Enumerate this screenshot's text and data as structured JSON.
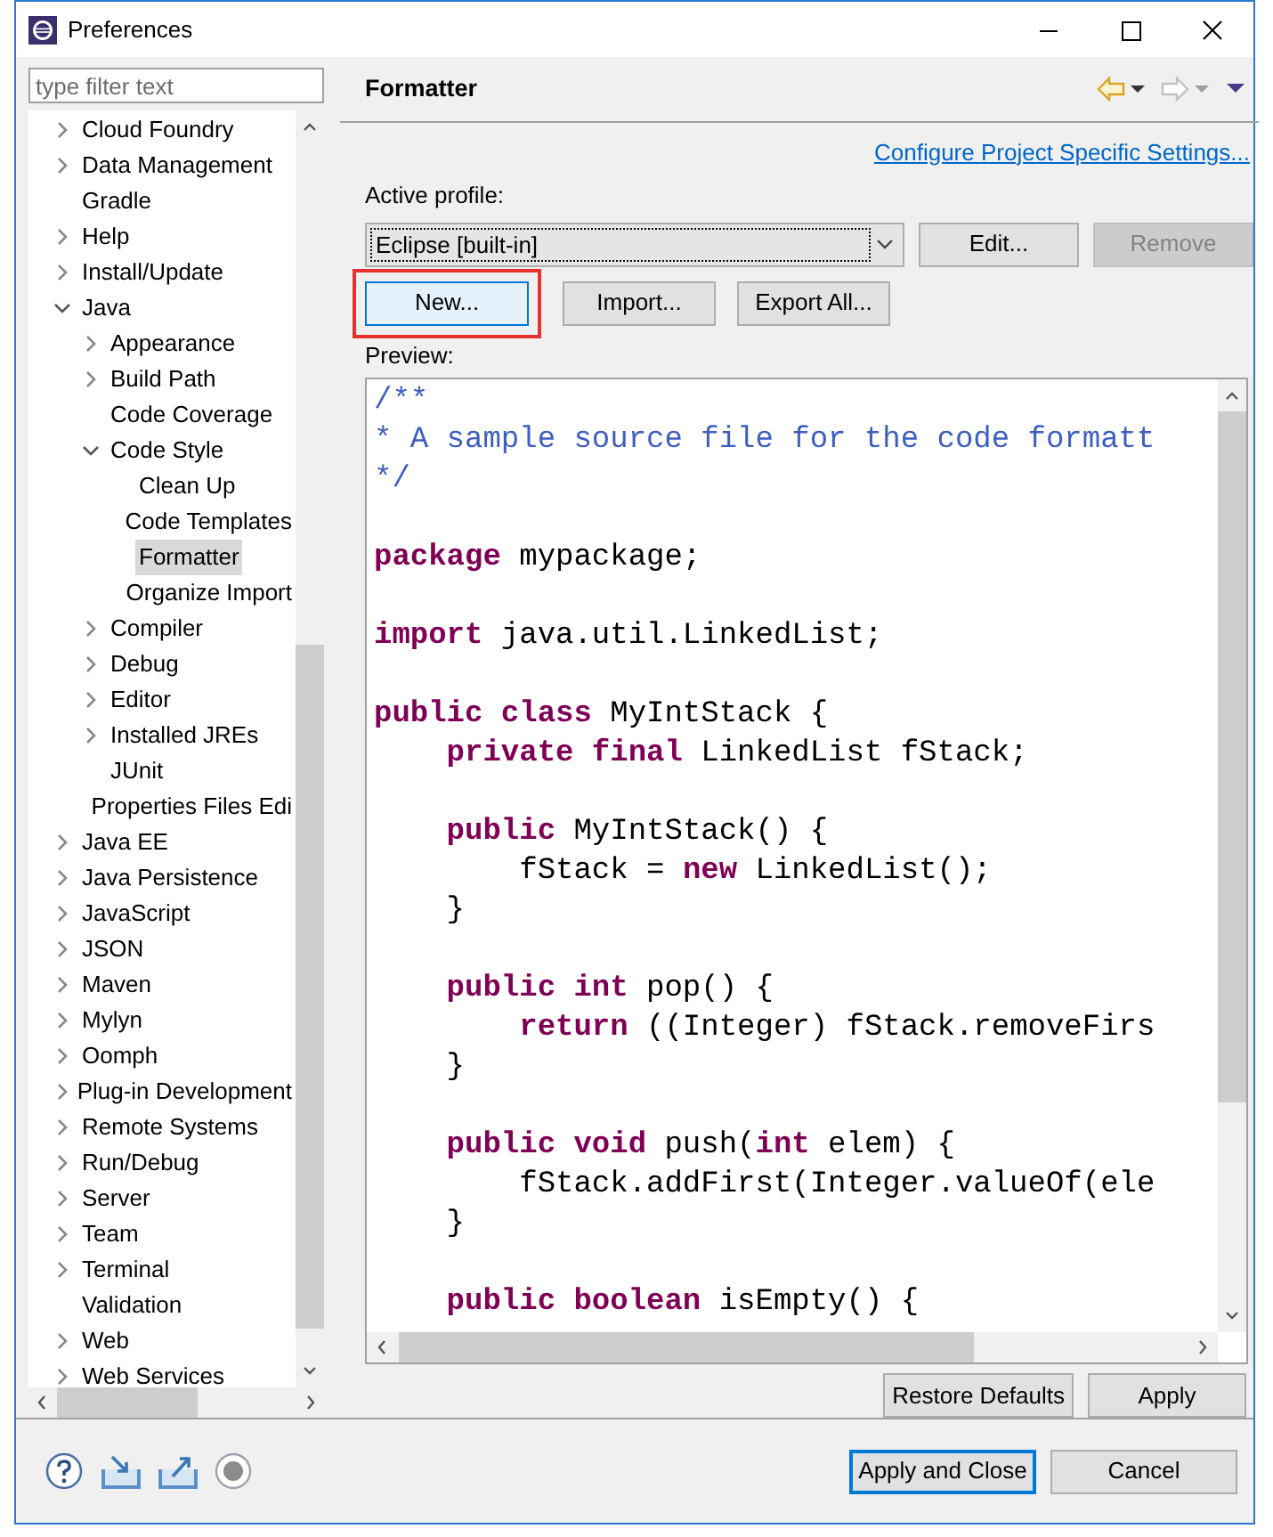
{
  "window": {
    "title": "Preferences"
  },
  "filter": {
    "placeholder": "type filter text"
  },
  "tree": [
    {
      "label": "Cloud Foundry",
      "expanded": false,
      "selected": false
    },
    {
      "label": "Data Management",
      "expanded": false,
      "selected": false
    },
    {
      "label": "Gradle",
      "selected": false
    },
    {
      "label": "Help",
      "expanded": false,
      "selected": false
    },
    {
      "label": "Install/Update",
      "expanded": false,
      "selected": false
    },
    {
      "label": "Java",
      "expanded": true,
      "selected": false,
      "children": [
        {
          "label": "Appearance",
          "expanded": false,
          "selected": false
        },
        {
          "label": "Build Path",
          "expanded": false,
          "selected": false
        },
        {
          "label": "Code Coverage",
          "selected": false
        },
        {
          "label": "Code Style",
          "expanded": true,
          "selected": false,
          "children": [
            {
              "label": "Clean Up",
              "selected": false
            },
            {
              "label": "Code Templates",
              "selected": false
            },
            {
              "label": "Formatter",
              "selected": true
            },
            {
              "label": "Organize Import",
              "selected": false
            }
          ]
        },
        {
          "label": "Compiler",
          "expanded": false,
          "selected": false
        },
        {
          "label": "Debug",
          "expanded": false,
          "selected": false
        },
        {
          "label": "Editor",
          "expanded": false,
          "selected": false
        },
        {
          "label": "Installed JREs",
          "expanded": false,
          "selected": false
        },
        {
          "label": "JUnit",
          "selected": false
        },
        {
          "label": "Properties Files Edi",
          "selected": false
        }
      ]
    },
    {
      "label": "Java EE",
      "expanded": false,
      "selected": false
    },
    {
      "label": "Java Persistence",
      "expanded": false,
      "selected": false
    },
    {
      "label": "JavaScript",
      "expanded": false,
      "selected": false
    },
    {
      "label": "JSON",
      "expanded": false,
      "selected": false
    },
    {
      "label": "Maven",
      "expanded": false,
      "selected": false
    },
    {
      "label": "Mylyn",
      "expanded": false,
      "selected": false
    },
    {
      "label": "Oomph",
      "expanded": false,
      "selected": false
    },
    {
      "label": "Plug-in Development",
      "expanded": false,
      "selected": false
    },
    {
      "label": "Remote Systems",
      "expanded": false,
      "selected": false
    },
    {
      "label": "Run/Debug",
      "expanded": false,
      "selected": false
    },
    {
      "label": "Server",
      "expanded": false,
      "selected": false
    },
    {
      "label": "Team",
      "expanded": false,
      "selected": false
    },
    {
      "label": "Terminal",
      "expanded": false,
      "selected": false
    },
    {
      "label": "Validation",
      "selected": false
    },
    {
      "label": "Web",
      "expanded": false,
      "selected": false
    },
    {
      "label": "Web Services",
      "expanded": false,
      "selected": false
    }
  ],
  "page": {
    "title": "Formatter",
    "link": "Configure Project Specific Settings...",
    "profile_label": "Active profile:",
    "profile": "Eclipse [built-in]",
    "profile_buttons": [
      {
        "label": "Edit...",
        "disabled": false
      },
      {
        "label": "Remove",
        "disabled": true
      }
    ],
    "actions": [
      {
        "label": "New...",
        "focused": true,
        "highlighted": true
      },
      {
        "label": "Import...",
        "focused": false,
        "highlighted": false
      },
      {
        "label": "Export All...",
        "focused": false,
        "highlighted": false
      }
    ],
    "preview_label": "Preview:",
    "code": [
      {
        "lines": [
          [
            {
              "text": "/**",
              "kind": "comment"
            }
          ],
          [
            {
              "text": "* A sample source file for the code formatt",
              "kind": "comment"
            }
          ],
          [
            {
              "text": "*/",
              "kind": "comment"
            }
          ]
        ]
      },
      {
        "lines": [
          [
            {
              "text": "package",
              "kind": "keyword"
            },
            {
              "text": " mypackage;",
              "kind": "plain"
            }
          ]
        ]
      },
      {
        "lines": [
          [
            {
              "text": "import",
              "kind": "keyword"
            },
            {
              "text": " java.util.LinkedList;",
              "kind": "plain"
            }
          ]
        ]
      },
      {
        "lines": [
          [
            {
              "text": "public class",
              "kind": "keyword"
            },
            {
              "text": " MyIntStack {",
              "kind": "plain"
            }
          ],
          [
            {
              "text": "    private final",
              "kind": "keyword"
            },
            {
              "text": " LinkedList fStack;",
              "kind": "plain"
            }
          ]
        ]
      },
      {
        "lines": [
          [
            {
              "text": "    public",
              "kind": "keyword"
            },
            {
              "text": " MyIntStack() {",
              "kind": "plain"
            }
          ],
          [
            {
              "text": "        fStack = ",
              "kind": "plain"
            },
            {
              "text": "new",
              "kind": "keyword"
            },
            {
              "text": " LinkedList();",
              "kind": "plain"
            }
          ],
          [
            {
              "text": "    }",
              "kind": "plain"
            }
          ]
        ]
      },
      {
        "lines": [
          [
            {
              "text": "    public int",
              "kind": "keyword"
            },
            {
              "text": " pop() {",
              "kind": "plain"
            }
          ],
          [
            {
              "text": "        return",
              "kind": "keyword"
            },
            {
              "text": " ((Integer) fStack.removeFirs",
              "kind": "plain"
            }
          ],
          [
            {
              "text": "    }",
              "kind": "plain"
            }
          ]
        ]
      },
      {
        "lines": [
          [
            {
              "text": "    public void",
              "kind": "keyword"
            },
            {
              "text": " push(",
              "kind": "plain"
            },
            {
              "text": "int",
              "kind": "keyword"
            },
            {
              "text": " elem) {",
              "kind": "plain"
            }
          ],
          [
            {
              "text": "        fStack.addFirst(Integer.valueOf(ele",
              "kind": "plain"
            }
          ],
          [
            {
              "text": "    }",
              "kind": "plain"
            }
          ]
        ]
      },
      {
        "lines": [
          [
            {
              "text": "    public boolean",
              "kind": "keyword"
            },
            {
              "text": " isEmpty() {",
              "kind": "plain"
            }
          ]
        ]
      }
    ],
    "page_buttons": [
      "Restore Defaults",
      "Apply"
    ]
  },
  "footer_buttons": [
    {
      "label": "Apply and Close",
      "default": true
    },
    {
      "label": "Cancel",
      "default": false
    }
  ]
}
